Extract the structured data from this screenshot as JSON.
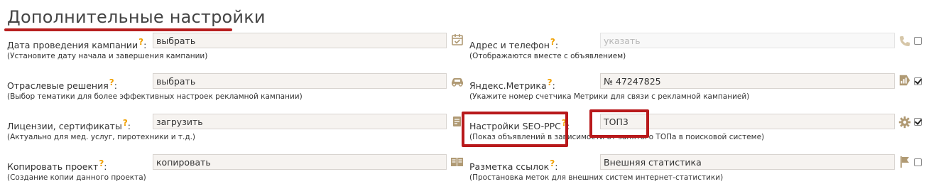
{
  "page": {
    "title": "Дополнительные настройки"
  },
  "help_mark": "?",
  "left": [
    {
      "label": "Дата проведения кампании",
      "hint": "(Установите дату начала и завершения кампании)",
      "value": "выбрать",
      "icon": "calendar-icon"
    },
    {
      "label": "Отраслевые решения",
      "hint": "(Выбор тематики для более эффективных настроек рекламной кампании)",
      "value": "выбрать",
      "icon": "car-icon"
    },
    {
      "label": "Лицензии, сертификаты",
      "hint": "(Актуально для мед. услуг, пиротехники и т.д.)",
      "value": "загрузить",
      "icon": "document-edit-icon"
    },
    {
      "label": "Копировать проект",
      "hint": "(Создание копии данного проекта)",
      "value": "копировать",
      "icon": "copy-icon"
    }
  ],
  "right": [
    {
      "label": "Адрес и телефон",
      "hint": "(Отображаются вместе с объявлением)",
      "value": "указать",
      "icon": "phone-icon",
      "checked": false
    },
    {
      "label": "Яндекс.Метрика",
      "hint": "(Укажите номер счетчика Метрики для связи с рекламной кампанией)",
      "value": "№ 47247825",
      "icon": "metrika-chart-icon",
      "checked": true
    },
    {
      "label": "Настройки SEO-PPC",
      "hint": "(Показ объявлений в зависимости от занятого ТОПа в поисковой системе)",
      "value": "ТОП3",
      "icon": "gear-icon",
      "checked": true
    },
    {
      "label": "Разметка ссылок",
      "hint": "(Простановка меток для внешних систем интернет-статистики)",
      "value": "Внешняя статистика",
      "icon": "flag-icon",
      "checked": false
    }
  ],
  "colors": {
    "accent_red": "#b8191b",
    "help_mark": "#f0a000",
    "icon_tan": "#c8b08a"
  }
}
